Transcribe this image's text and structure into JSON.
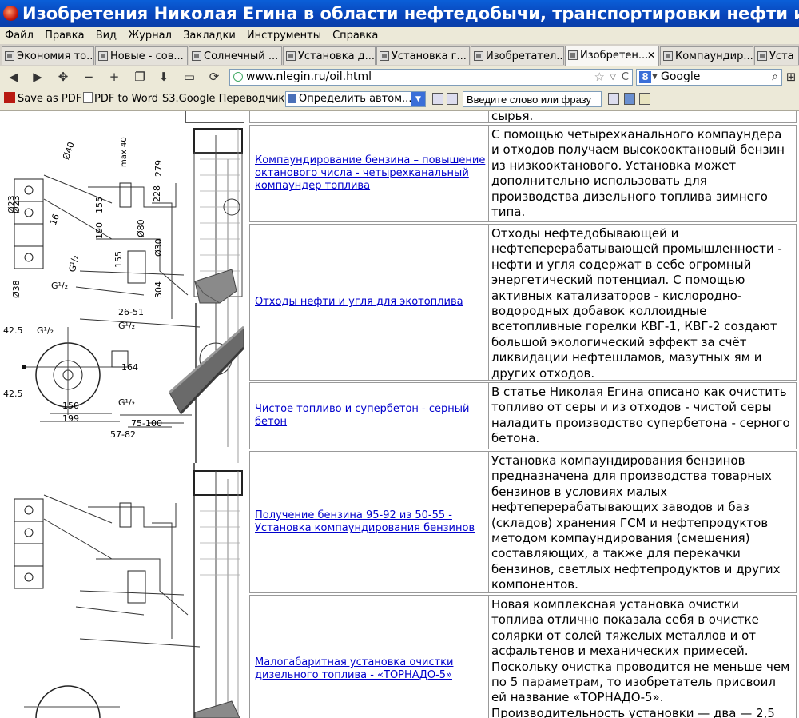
{
  "window": {
    "title": "Изобретения Николая Егина в области нефтедобычи, транспортировки нефти и в нефтепер..."
  },
  "menu": [
    "Файл",
    "Правка",
    "Вид",
    "Журнал",
    "Закладки",
    "Инструменты",
    "Справка"
  ],
  "tabs": [
    {
      "label": "Экономия то..."
    },
    {
      "label": "Новые - сов..."
    },
    {
      "label": "Солнечный ..."
    },
    {
      "label": "Установка д..."
    },
    {
      "label": "Установка г..."
    },
    {
      "label": "Изобретател..."
    },
    {
      "label": "Изобретен...",
      "active": true
    },
    {
      "label": "Компаундир..."
    },
    {
      "label": "Уста"
    }
  ],
  "nav": {
    "url": "www.nlegin.ru/oil.html",
    "search_engine": "Google"
  },
  "toolbar": {
    "save_pdf": "Save as PDF",
    "pdf_word": "PDF to Word",
    "translator": "S3.Google Переводчик",
    "detect_lang": "Определить автом...",
    "word_input": "Введите слово или фразу"
  },
  "table": {
    "top_fragment": "сырья.",
    "rows": [
      {
        "link": "Компаундирование бензина – повышение октанового числа - четырехканальный компаундер топлива",
        "desc": "С помощью четырехканального компаундера и отходов получаем высокооктановый бензин из низкооктанового. Установка может дополнительно использовать для производства дизельного топлива зимнего типа."
      },
      {
        "link": "Отходы нефти и угля для экотоплива",
        "desc": "Отходы нефтедобывающей и нефтеперерабатывающей промышленности - нефти и угля содержат в себе огромный энергетический потенциал. С помощью активных катализаторов - кислородно-водородных добавок коллоидные всетопливные горелки КВГ-1, КВГ-2 создают большой экологический эффект за счёт ликвидации нефтешламов, мазутных ям и других отходов."
      },
      {
        "link": "Чистое топливо и супербетон - серный бетон",
        "desc": "В статье Николая Егина описано как очистить топливо от серы и из отходов - чистой серы наладить производство супербетона - серного бетона."
      },
      {
        "link": "Получение бензина 95-92 из 50-55 - Установка компаундирования бензинов",
        "desc": "Установка компаундирования бензинов предназначена для производства товарных бензинов в условиях малых нефтеперерабатывающих заводов и баз (складов) хранения ГСМ и нефтепродуктов методом компаундирования (смешения) составляющих, а также для перекачки бензинов, светлых нефтепродуктов и других компонентов."
      },
      {
        "link": "Малогабаритная установка очистки дизельного топлива - «ТОРНАДО-5»",
        "desc": "Новая комплексная установка очистки топлива отлично показала себя в очистке солярки от солей тяжелых металлов и от асфальтенов и механических примесей. Поскольку очистка проводится не меньше чем по 5 параметрам, то изобретатель присвоил ей название «ТОРНАДО-5». Производительность установки — два — 2,5"
      }
    ]
  },
  "drawing_labels": {
    "d40": "Ø40",
    "d23": "Ø23",
    "max40": "max 40",
    "n279": "279",
    "n228": "228",
    "n155a": "155",
    "n190": "190",
    "d80": "Ø80",
    "n16": "16",
    "d38": "Ø38",
    "d30": "Ø30",
    "n155b": "155",
    "g12a": "G¹/₂",
    "g12b": "G¹/₂",
    "n304": "304",
    "n2651": "26-51",
    "g12c": "G¹/₂",
    "n425a": "42.5",
    "g12d": "G¹/₂",
    "n164": "164",
    "n425b": "42.5",
    "g12e": "G¹/₂",
    "n150": "150",
    "n199": "199",
    "n75100": "75-100",
    "n5782": "57-82"
  }
}
